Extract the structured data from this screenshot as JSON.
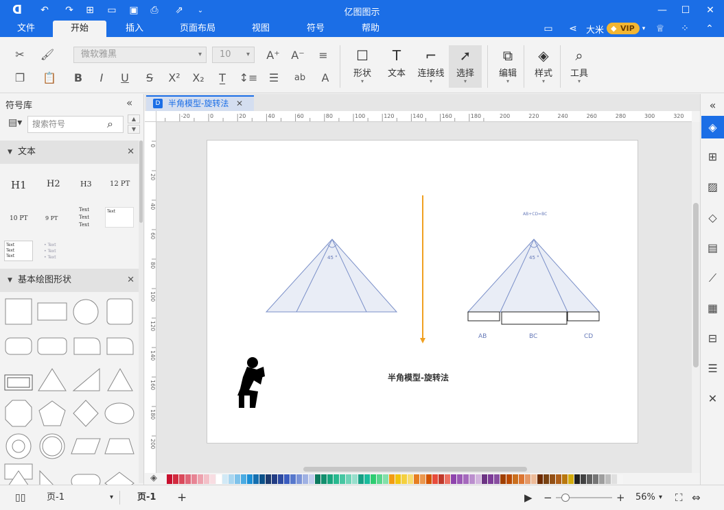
{
  "app": {
    "title": "亿图图示"
  },
  "menu": {
    "tabs": [
      {
        "label": "文件"
      },
      {
        "label": "开始"
      },
      {
        "label": "插入"
      },
      {
        "label": "页面布局"
      },
      {
        "label": "视图"
      },
      {
        "label": "符号"
      },
      {
        "label": "帮助"
      }
    ],
    "user": "大米",
    "vip": "VIP"
  },
  "ribbon": {
    "font_family": "微软雅黑",
    "font_size": "10",
    "shape": "形状",
    "text": "文本",
    "connector": "连接线",
    "select": "选择",
    "edit": "编辑",
    "style": "样式",
    "tools": "工具"
  },
  "library": {
    "title": "符号库",
    "search_placeholder": "搜索符号",
    "text_section": "文本",
    "shapes_section": "基本绘图形状",
    "samples": {
      "h1": "H1",
      "h2": "H2",
      "h3": "H3",
      "pt12": "12 PT",
      "pt10": "10 PT",
      "pt9": "9 PT",
      "text": "Text"
    }
  },
  "document": {
    "tab_name": "半角模型-旋转法",
    "angle_left": "45 °",
    "angle_right": "45 °",
    "formula": "AB+CD=BC",
    "seg_ab": "AB",
    "seg_bc": "BC",
    "seg_cd": "CD",
    "caption": "半角模型-旋转法"
  },
  "rulers": {
    "h_ticks": [
      "-20",
      "0",
      "20",
      "40",
      "60",
      "80",
      "100",
      "120",
      "140",
      "160",
      "180",
      "200",
      "220",
      "240",
      "260",
      "280",
      "300",
      "320"
    ],
    "v_ticks": [
      "0",
      "20",
      "40",
      "60",
      "80",
      "100",
      "120",
      "140",
      "160",
      "180",
      "200"
    ]
  },
  "status": {
    "page_select": "页-1",
    "page_tab": "页-1",
    "zoom": "56%"
  },
  "colors": {
    "accent": "#1b6ee6",
    "arrow": "#f0a020",
    "triangle_fill": "#e9edf6",
    "triangle_stroke": "#7a8fc8"
  },
  "palette": [
    "#c8102e",
    "#d22b3f",
    "#da4a5c",
    "#e06678",
    "#e78494",
    "#eda2ae",
    "#f3c0c8",
    "#f8dde2",
    "#ffffff",
    "#d1e9f6",
    "#a9d6f0",
    "#7ec2ea",
    "#4aabe2",
    "#1b8fd6",
    "#146fb0",
    "#0c5189",
    "#1d3a6e",
    "#233d84",
    "#2d4aa1",
    "#3a5cbf",
    "#5778cc",
    "#7b94d8",
    "#9fb1e3",
    "#c3ceee",
    "#0d7a5f",
    "#138f6e",
    "#19a57e",
    "#28b98f",
    "#47c6a2",
    "#6fd3b7",
    "#97dfcc",
    "#16a085",
    "#1abc9c",
    "#2ecc71",
    "#58d68d",
    "#82e0aa",
    "#f39c12",
    "#f1c40f",
    "#f4d03f",
    "#f7dc6f",
    "#e67e22",
    "#eb984e",
    "#d35400",
    "#e74c3c",
    "#c0392b",
    "#ec7063",
    "#8e44ad",
    "#9b59b6",
    "#a569bd",
    "#bb8fce",
    "#d2b4de",
    "#6c3483",
    "#7d3c98",
    "#884ea0",
    "#a04000",
    "#ba4a00",
    "#ca6f1e",
    "#dc7633",
    "#e59866",
    "#edbb99",
    "#6e2c00",
    "#784212",
    "#935116",
    "#af601a",
    "#b9770e",
    "#d4ac0d",
    "#212121",
    "#424242",
    "#616161",
    "#757575",
    "#9e9e9e",
    "#bdbdbd",
    "#e0e0e0",
    "#f5f5f5"
  ],
  "right_panel": [
    "paint-bucket-icon",
    "grid-icon",
    "image-icon",
    "layers-icon",
    "page-icon",
    "chart-icon",
    "table-icon",
    "org-icon",
    "list-icon",
    "shuffle-icon"
  ]
}
